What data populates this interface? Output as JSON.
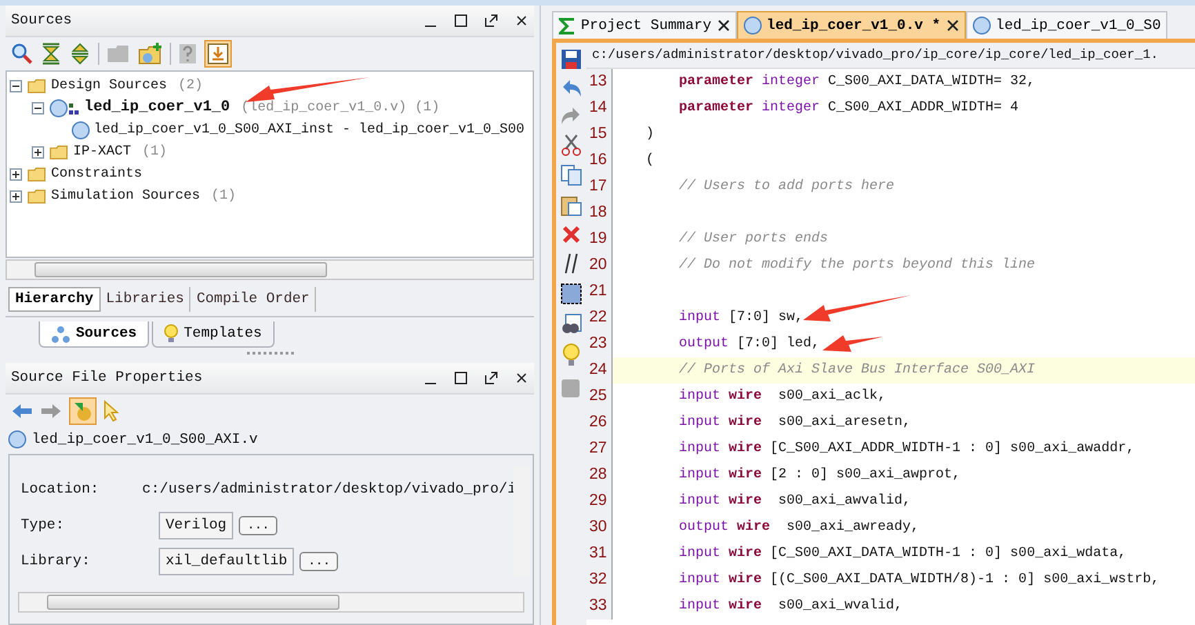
{
  "sources": {
    "title": "Sources",
    "tree": [
      {
        "kind": "folder",
        "label": "Design Sources",
        "detail": "(2)",
        "top": false,
        "expanded": true,
        "children": [
          {
            "kind": "module",
            "label": "led_ip_coer_v1_0",
            "detail": "(led_ip_coer_v1_0.v) (1)",
            "top": true,
            "expanded": true,
            "children": [
              {
                "kind": "verilog",
                "label": "led_ip_coer_v1_0_S00_AXI_inst - led_ip_coer_v1_0_S00",
                "top": false
              }
            ]
          },
          {
            "kind": "folder",
            "label": "IP-XACT",
            "detail": "(1)",
            "top": false,
            "expanded": false
          }
        ]
      },
      {
        "kind": "folder",
        "label": "Constraints",
        "top": false,
        "expanded": false
      },
      {
        "kind": "folder",
        "label": "Simulation Sources",
        "detail": "(1)",
        "top": false,
        "expanded": false
      }
    ],
    "view_tabs": [
      {
        "label": "Hierarchy",
        "selected": true
      },
      {
        "label": "Libraries",
        "selected": false
      },
      {
        "label": "Compile Order",
        "selected": false
      }
    ],
    "panel_tabs": [
      {
        "label": "Sources",
        "selected": true
      },
      {
        "label": "Templates",
        "selected": false
      }
    ]
  },
  "properties": {
    "title": "Source File Properties",
    "file": "led_ip_coer_v1_0_S00_AXI.v",
    "rows": [
      {
        "label": "Location:",
        "kind": "text",
        "value": "c:/users/administrator/desktop/vivado_pro/i"
      },
      {
        "label": "Type:",
        "kind": "field",
        "value": "Verilog",
        "button": "..."
      },
      {
        "label": "Library:",
        "kind": "field",
        "value": "xil_defaultlib",
        "button": "..."
      }
    ]
  },
  "editor": {
    "tabs": [
      {
        "label": "Project Summary",
        "kind": "summary",
        "selected": false
      },
      {
        "label": "led_ip_coer_v1_0.v *",
        "kind": "file",
        "selected": true
      },
      {
        "label": "led_ip_coer_v1_0_S0",
        "kind": "file",
        "selected": false
      }
    ],
    "path": "c:/users/administrator/desktop/vivado_pro/ip_core/ip_core/led_ip_coer_1.",
    "lines": [
      {
        "number": "13",
        "indented": true,
        "current": false,
        "tokens": [
          {
            "kind": "keyword",
            "text": "parameter"
          },
          {
            "kind": "type",
            "text": " integer"
          },
          {
            "kind": "plain",
            "text": " C_S00_AXI_DATA_WIDTH= 32,"
          }
        ]
      },
      {
        "number": "14",
        "indented": true,
        "current": false,
        "tokens": [
          {
            "kind": "keyword",
            "text": "parameter"
          },
          {
            "kind": "type",
            "text": " integer"
          },
          {
            "kind": "plain",
            "text": " C_S00_AXI_ADDR_WIDTH= 4"
          }
        ]
      },
      {
        "number": "15",
        "indented": false,
        "current": false,
        "tokens": [
          {
            "kind": "plain",
            "text": ")"
          }
        ]
      },
      {
        "number": "16",
        "indented": false,
        "current": false,
        "tokens": [
          {
            "kind": "plain",
            "text": "("
          }
        ]
      },
      {
        "number": "17",
        "indented": true,
        "current": false,
        "tokens": [
          {
            "kind": "comment",
            "text": "// Users to add ports here"
          }
        ]
      },
      {
        "number": "18",
        "current": false
      },
      {
        "number": "19",
        "indented": true,
        "current": false,
        "tokens": [
          {
            "kind": "comment",
            "text": "// User ports ends"
          }
        ]
      },
      {
        "number": "20",
        "indented": true,
        "current": false,
        "tokens": [
          {
            "kind": "comment",
            "text": "// Do not modify the ports beyond this line"
          }
        ]
      },
      {
        "number": "21",
        "current": false
      },
      {
        "number": "22",
        "indented": true,
        "current": false,
        "tokens": [
          {
            "kind": "type",
            "text": "input"
          },
          {
            "kind": "plain",
            "text": " [7:0] sw,"
          }
        ]
      },
      {
        "number": "23",
        "indented": true,
        "current": false,
        "tokens": [
          {
            "kind": "type",
            "text": "output"
          },
          {
            "kind": "plain",
            "text": " [7:0] led,"
          }
        ]
      },
      {
        "number": "24",
        "indented": true,
        "current": true,
        "tokens": [
          {
            "kind": "comment",
            "text": "// Ports of Axi Slave Bus Interface S00_AXI"
          }
        ]
      },
      {
        "number": "25",
        "indented": true,
        "current": false,
        "tokens": [
          {
            "kind": "type",
            "text": "input"
          },
          {
            "kind": "keyword",
            "text": " wire"
          },
          {
            "kind": "plain",
            "text": "  s00_axi_aclk,"
          }
        ]
      },
      {
        "number": "26",
        "indented": true,
        "current": false,
        "tokens": [
          {
            "kind": "type",
            "text": "input"
          },
          {
            "kind": "keyword",
            "text": " wire"
          },
          {
            "kind": "plain",
            "text": "  s00_axi_aresetn,"
          }
        ]
      },
      {
        "number": "27",
        "indented": true,
        "current": false,
        "tokens": [
          {
            "kind": "type",
            "text": "input"
          },
          {
            "kind": "keyword",
            "text": " wire"
          },
          {
            "kind": "plain",
            "text": " [C_S00_AXI_ADDR_WIDTH-1 : 0] s00_axi_awaddr,"
          }
        ]
      },
      {
        "number": "28",
        "indented": true,
        "current": false,
        "tokens": [
          {
            "kind": "type",
            "text": "input"
          },
          {
            "kind": "keyword",
            "text": " wire"
          },
          {
            "kind": "plain",
            "text": " [2 : 0] s00_axi_awprot,"
          }
        ]
      },
      {
        "number": "29",
        "indented": true,
        "current": false,
        "tokens": [
          {
            "kind": "type",
            "text": "input"
          },
          {
            "kind": "keyword",
            "text": " wire"
          },
          {
            "kind": "plain",
            "text": "  s00_axi_awvalid,"
          }
        ]
      },
      {
        "number": "30",
        "indented": true,
        "current": false,
        "tokens": [
          {
            "kind": "type",
            "text": "output"
          },
          {
            "kind": "keyword",
            "text": " wire"
          },
          {
            "kind": "plain",
            "text": "  s00_axi_awready,"
          }
        ]
      },
      {
        "number": "31",
        "indented": true,
        "current": false,
        "tokens": [
          {
            "kind": "type",
            "text": "input"
          },
          {
            "kind": "keyword",
            "text": " wire"
          },
          {
            "kind": "plain",
            "text": " [C_S00_AXI_DATA_WIDTH-1 : 0] s00_axi_wdata,"
          }
        ]
      },
      {
        "number": "32",
        "indented": true,
        "current": false,
        "tokens": [
          {
            "kind": "type",
            "text": "input"
          },
          {
            "kind": "keyword",
            "text": " wire"
          },
          {
            "kind": "plain",
            "text": " [(C_S00_AXI_DATA_WIDTH/8)-1 : 0] s00_axi_wstrb,"
          }
        ]
      },
      {
        "number": "33",
        "indented": true,
        "current": false,
        "tokens": [
          {
            "kind": "type",
            "text": "input"
          },
          {
            "kind": "keyword",
            "text": " wire"
          },
          {
            "kind": "plain",
            "text": "  s00_axi_wvalid,"
          }
        ]
      }
    ]
  }
}
